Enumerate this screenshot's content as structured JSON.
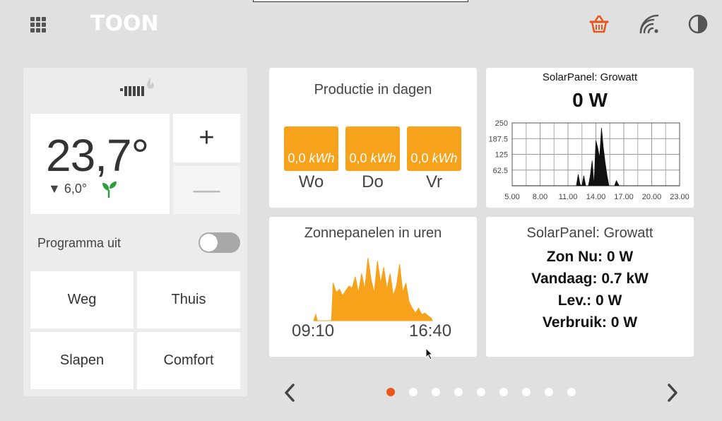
{
  "header": {
    "logo": "TOON"
  },
  "icons": {
    "apps": "apps-grid-icon",
    "basket": "basket-icon",
    "wifi": "wifi-icon",
    "contrast": "contrast-icon"
  },
  "colors": {
    "accent": "#f7a21b",
    "active_dot": "#e8561b",
    "basket": "#e8561b"
  },
  "thermostat": {
    "current_temp": "23,7°",
    "setpoint": "▼ 6,0°",
    "plus_label": "+",
    "minus_label": "—",
    "program_label": "Programma uit",
    "program_on": false,
    "modes": [
      "Weg",
      "Thuis",
      "Slapen",
      "Comfort"
    ]
  },
  "tiles": {
    "production_days": {
      "title": "Productie in dagen",
      "days": [
        {
          "value": "0,0",
          "unit": "kWh",
          "label": "Wo"
        },
        {
          "value": "0,0",
          "unit": "kWh",
          "label": "Do"
        },
        {
          "value": "0,0",
          "unit": "kWh",
          "label": "Vr"
        }
      ]
    },
    "solar_chart": {
      "title": "SolarPanel: Growatt",
      "current": "0 W"
    },
    "hours": {
      "title": "Zonnepanelen in uren",
      "start_time": "09:10",
      "end_time": "16:40"
    },
    "stats": {
      "title": "SolarPanel: Growatt",
      "lines": [
        "Zon Nu: 0 W",
        "Vandaag: 0.7 kW",
        "Lev.: 0 W",
        "Verbruik: 0 W"
      ]
    }
  },
  "pager": {
    "total": 9,
    "active_index": 0
  },
  "chart_data": [
    {
      "type": "area",
      "title": "SolarPanel: Growatt",
      "xlabel": "",
      "ylabel": "",
      "x_ticks": [
        "5.00",
        "8.00",
        "11.00",
        "14.00",
        "17.00",
        "20.00",
        "23.00"
      ],
      "y_ticks": [
        "250",
        "187.5",
        "125",
        "62.5"
      ],
      "xlim": [
        5,
        23
      ],
      "ylim": [
        0,
        250
      ],
      "grid": true,
      "series": [
        {
          "x": [
            5,
            11.9,
            12.1,
            12.3,
            12.5,
            12.7,
            12.9,
            13.2,
            13.4,
            13.6,
            13.8,
            14.0,
            14.2,
            14.4,
            14.6,
            14.8,
            15.0,
            15.2,
            15.4,
            15.6,
            15.8,
            16.0,
            16.2,
            16.5,
            16.7,
            23
          ],
          "y": [
            0,
            0,
            45,
            5,
            0,
            40,
            0,
            0,
            40,
            100,
            0,
            180,
            150,
            110,
            230,
            150,
            90,
            40,
            0,
            0,
            0,
            0,
            20,
            0,
            0,
            0
          ]
        }
      ]
    },
    {
      "type": "area",
      "title": "Zonnepanelen in uren",
      "x_ticks": [
        "09:10",
        "16:40"
      ],
      "xlim": [
        9.17,
        16.67
      ],
      "series": [
        {
          "x": [
            9.17,
            9.3,
            9.4,
            9.5,
            10.3,
            10.4,
            10.6,
            10.8,
            11.0,
            11.2,
            11.4,
            11.6,
            11.8,
            12.0,
            12.2,
            12.4,
            12.6,
            12.8,
            13.0,
            13.2,
            13.4,
            13.6,
            13.8,
            14.0,
            14.2,
            14.4,
            14.6,
            14.8,
            15.0,
            15.2,
            15.4,
            15.6,
            15.8,
            16.0,
            16.2,
            16.4,
            16.6,
            16.67
          ],
          "y": [
            0,
            10,
            0,
            0,
            0,
            60,
            45,
            50,
            40,
            48,
            55,
            52,
            70,
            45,
            75,
            50,
            100,
            65,
            45,
            95,
            60,
            85,
            50,
            75,
            40,
            55,
            90,
            45,
            60,
            30,
            20,
            12,
            20,
            10,
            12,
            8,
            4,
            0
          ]
        }
      ]
    }
  ]
}
